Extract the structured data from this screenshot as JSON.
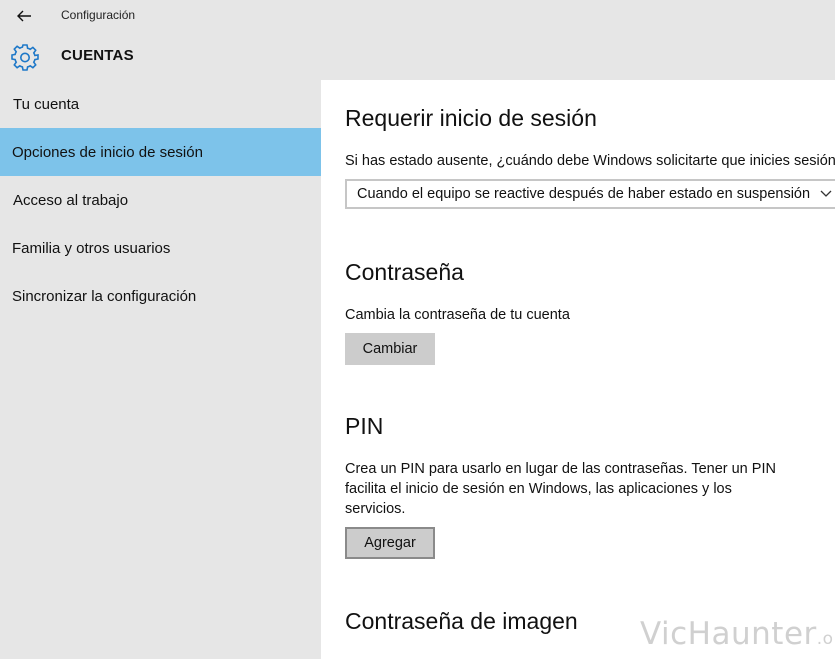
{
  "window": {
    "title": "Configuración"
  },
  "header": {
    "section": "CUENTAS",
    "icon": "gear-icon"
  },
  "sidebar": {
    "items": [
      {
        "label": "Tu cuenta",
        "active": false
      },
      {
        "label": "Opciones de inicio de sesión",
        "active": true
      },
      {
        "label": "Acceso al trabajo",
        "active": false
      },
      {
        "label": "Familia y otros usuarios",
        "active": false
      },
      {
        "label": "Sincronizar la configuración",
        "active": false
      }
    ]
  },
  "main": {
    "require_signin": {
      "heading": "Requerir inicio de sesión",
      "question": "Si has estado ausente, ¿cuándo debe Windows solicitarte que inicies sesión",
      "selected_option": "Cuando el equipo se reactive después de haber estado en suspensión"
    },
    "password": {
      "heading": "Contraseña",
      "description": "Cambia la contraseña de tu cuenta",
      "button": "Cambiar"
    },
    "pin": {
      "heading": "PIN",
      "description": "Crea un PIN para usarlo en lugar de las contraseñas. Tener un PIN facilita el inicio de sesión en Windows, las aplicaciones y los servicios.",
      "button": "Agregar"
    },
    "picture_password": {
      "heading": "Contraseña de imagen"
    }
  },
  "watermark": {
    "text": "VicHaunter",
    "suffix": ".org"
  },
  "colors": {
    "accent": "#1e78c8",
    "active_item": "#7dc3ea",
    "chrome": "#e6e6e6",
    "button": "#cccccc"
  }
}
